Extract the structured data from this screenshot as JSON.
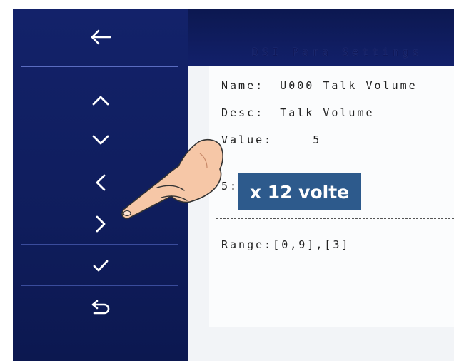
{
  "screen": {
    "title": "DSI Para Settings"
  },
  "sidebar": {
    "buttons": [
      {
        "name": "back",
        "icon": "arrow-left-icon"
      },
      {
        "name": "up",
        "icon": "chevron-up-icon"
      },
      {
        "name": "down",
        "icon": "chevron-down-icon"
      },
      {
        "name": "left",
        "icon": "chevron-left-icon"
      },
      {
        "name": "right",
        "icon": "chevron-right-icon"
      },
      {
        "name": "confirm",
        "icon": "checkmark-icon"
      },
      {
        "name": "return",
        "icon": "return-arrow-icon"
      }
    ]
  },
  "param": {
    "name_label": "Name:",
    "name_value": "U000 Talk Volume",
    "desc_label": "Desc:",
    "desc_value": "Talk Volume",
    "value_label": "Value:",
    "value_value": "5",
    "edit_prefix": "5:",
    "range_text": "Range:[0,9],[3]"
  },
  "overlay": {
    "label": "x 12 volte",
    "hand_icon": "pointing-hand-icon"
  },
  "colors": {
    "sidebar_bg": "#13226a",
    "highlight_bg": "#2d5a8c",
    "icon_color": "#ffffff"
  }
}
